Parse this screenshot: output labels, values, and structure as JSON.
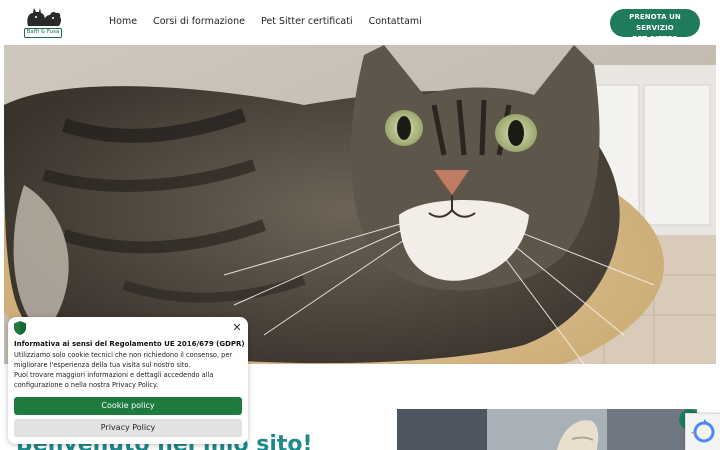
{
  "header": {
    "logo_text": "Baffi & Fusa",
    "nav": [
      "Home",
      "Corsi di formazione",
      "Pet Sitter certificati",
      "Contattami"
    ],
    "cta_line1": "PRENOTA UN SERVIZIO",
    "cta_line2": "PET SITTER"
  },
  "main": {
    "heading": "Benvenuto nel mio sito!"
  },
  "cookie": {
    "title": "Informativa ai sensi del Regolamento UE 2016/679 (GDPR)",
    "line1": "Utilizziamo solo cookie tecnici che non richiedono il consenso, per",
    "line2": "migliorare l'esperienza della tua visita sul nostro sito.",
    "line3": "Puoi trovare maggiori informazioni e dettagli accedendo alla",
    "line4": "configurazione o nella nostra Privacy Policy.",
    "cookie_policy_label": "Cookie policy",
    "privacy_policy_label": "Privacy Policy"
  },
  "colors": {
    "brand_green": "#1f7a5e",
    "policy_green": "#1f7a3f",
    "heading_teal": "#1f8a8a"
  },
  "icons": {
    "shield": "shield-icon",
    "close": "close-icon",
    "scroll_top": "chevron-up-icon"
  }
}
